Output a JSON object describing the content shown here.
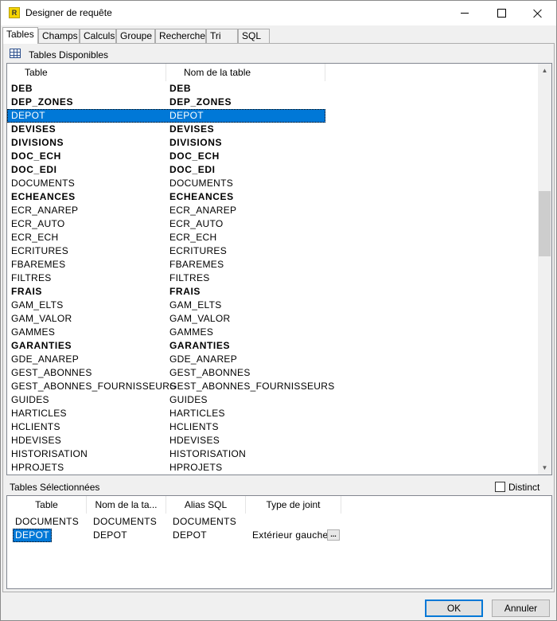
{
  "window": {
    "title": "Designer de requête",
    "app_icon_text": "R"
  },
  "tabs": [
    {
      "label": "Tables",
      "active": true
    },
    {
      "label": "Champs"
    },
    {
      "label": "Calculs"
    },
    {
      "label": "Groupe"
    },
    {
      "label": "Recherche"
    },
    {
      "label": "Tri"
    },
    {
      "label": "SQL"
    }
  ],
  "available": {
    "title": "Tables Disponibles",
    "columns": [
      "Table",
      "Nom de la table"
    ],
    "rows": [
      {
        "table": "DEB",
        "name": "DEB",
        "bold": true
      },
      {
        "table": "DEP_ZONES",
        "name": "DEP_ZONES",
        "bold": true
      },
      {
        "table": "DEPOT",
        "name": "DEPOT",
        "selected": true
      },
      {
        "table": "DEVISES",
        "name": "DEVISES",
        "bold": true
      },
      {
        "table": "DIVISIONS",
        "name": "DIVISIONS",
        "bold": true
      },
      {
        "table": "DOC_ECH",
        "name": "DOC_ECH",
        "bold": true
      },
      {
        "table": "DOC_EDI",
        "name": "DOC_EDI",
        "bold": true
      },
      {
        "table": "DOCUMENTS",
        "name": "DOCUMENTS"
      },
      {
        "table": "ECHEANCES",
        "name": "ECHEANCES",
        "bold": true
      },
      {
        "table": "ECR_ANAREP",
        "name": "ECR_ANAREP"
      },
      {
        "table": "ECR_AUTO",
        "name": "ECR_AUTO"
      },
      {
        "table": "ECR_ECH",
        "name": "ECR_ECH"
      },
      {
        "table": "ECRITURES",
        "name": "ECRITURES"
      },
      {
        "table": "FBAREMES",
        "name": "FBAREMES"
      },
      {
        "table": "FILTRES",
        "name": "FILTRES"
      },
      {
        "table": "FRAIS",
        "name": "FRAIS",
        "bold": true
      },
      {
        "table": "GAM_ELTS",
        "name": "GAM_ELTS"
      },
      {
        "table": "GAM_VALOR",
        "name": "GAM_VALOR"
      },
      {
        "table": "GAMMES",
        "name": "GAMMES"
      },
      {
        "table": "GARANTIES",
        "name": "GARANTIES",
        "bold": true
      },
      {
        "table": "GDE_ANAREP",
        "name": "GDE_ANAREP"
      },
      {
        "table": "GEST_ABONNES",
        "name": "GEST_ABONNES"
      },
      {
        "table": "GEST_ABONNES_FOURNISSEURS",
        "name": "GEST_ABONNES_FOURNISSEURS"
      },
      {
        "table": "GUIDES",
        "name": "GUIDES"
      },
      {
        "table": "HARTICLES",
        "name": "HARTICLES"
      },
      {
        "table": "HCLIENTS",
        "name": "HCLIENTS"
      },
      {
        "table": "HDEVISES",
        "name": "HDEVISES"
      },
      {
        "table": "HISTORISATION",
        "name": "HISTORISATION"
      },
      {
        "table": "HPROJETS",
        "name": "HPROJETS"
      }
    ]
  },
  "selected": {
    "title": "Tables Sélectionnées",
    "distinct_label": "Distinct",
    "distinct_checked": false,
    "columns": [
      "Table",
      "Nom de la ta...",
      "Alias SQL",
      "Type de joint"
    ],
    "rows": [
      {
        "table": "DOCUMENTS",
        "name": "DOCUMENTS",
        "alias": "DOCUMENTS",
        "join": ""
      },
      {
        "table": "DEPOT",
        "name": "DEPOT",
        "alias": "DEPOT",
        "join": "Extérieur gauche",
        "join_button": "..."
      }
    ]
  },
  "buttons": {
    "ok": "OK",
    "cancel": "Annuler"
  }
}
